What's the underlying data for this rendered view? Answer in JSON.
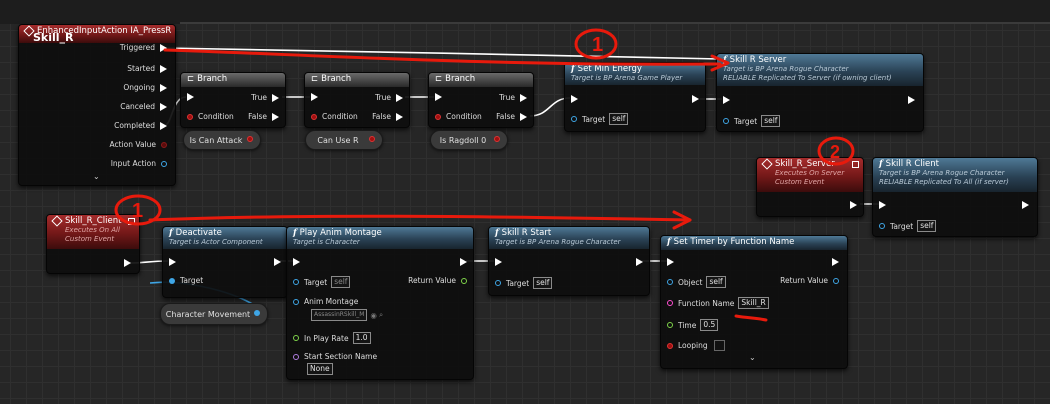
{
  "nodes": {
    "input_action": {
      "title": "EnhancedInputAction IA_PressR",
      "label": "Skill_R",
      "pins": [
        "Triggered",
        "Started",
        "Ongoing",
        "Canceled",
        "Completed",
        "Action Value",
        "Input Action"
      ]
    },
    "branch1": {
      "title": "Branch",
      "true_label": "True",
      "false_label": "False",
      "condition_label": "Condition"
    },
    "branch2": {
      "title": "Branch",
      "true_label": "True",
      "false_label": "False",
      "condition_label": "Condition"
    },
    "branch3": {
      "title": "Branch",
      "true_label": "True",
      "false_label": "False",
      "condition_label": "Condition"
    },
    "is_can_attack": {
      "label": "Is Can Attack"
    },
    "can_use_r": {
      "label": "Can Use R"
    },
    "is_ragdoll": {
      "label": "Is Ragdoll 0"
    },
    "set_min_energy": {
      "title": "Set Min Energy",
      "subtitle": "Target is BP Arena Game Player",
      "target_label": "Target",
      "target_value": "self"
    },
    "skill_r_server": {
      "title": "Skill R Server",
      "subtitle1": "Target is BP Arena Rogue Character",
      "subtitle2": "RELIABLE Replicated To Server (if owning client)",
      "target_label": "Target",
      "target_value": "self"
    },
    "skill_r_server_event": {
      "title": "Skill_R_Server",
      "subtitle1": "Executes On Server",
      "subtitle2": "Custom Event"
    },
    "skill_r_client": {
      "title": "Skill R Client",
      "subtitle1": "Target is BP Arena Rogue Character",
      "subtitle2": "RELIABLE Replicated To All (if server)",
      "target_label": "Target",
      "target_value": "self"
    },
    "skill_r_client_event": {
      "title": "Skill_R_Client",
      "subtitle1": "Executes On All",
      "subtitle2": "Custom Event"
    },
    "deactivate": {
      "title": "Deactivate",
      "subtitle": "Target is Actor Component",
      "target_label": "Target"
    },
    "character_movement": {
      "label": "Character Movement"
    },
    "play_anim_montage": {
      "title": "Play Anim Montage",
      "subtitle": "Target is Character",
      "target_label": "Target",
      "target_value": "self",
      "return_label": "Return Value",
      "anim_label": "Anim Montage",
      "anim_value": "AssassinRSkill_M",
      "rate_label": "In Play Rate",
      "rate_value": "1.0",
      "section_label": "Start Section Name",
      "section_value": "None"
    },
    "skill_r_start": {
      "title": "Skill R Start",
      "subtitle": "Target is BP Arena Rogue Character",
      "target_label": "Target",
      "target_value": "self"
    },
    "set_timer": {
      "title": "Set Timer by Function Name",
      "object_label": "Object",
      "object_value": "self",
      "return_label": "Return Value",
      "fn_label": "Function Name",
      "fn_value": "Skill_R",
      "time_label": "Time",
      "time_value": "0.5",
      "looping_label": "Looping"
    }
  },
  "annotations": {
    "num1": "1",
    "num2": "2",
    "num3": "1",
    "annotation_color": "#e81a0c"
  },
  "colors": {
    "exec": "#ffffff",
    "object_pin": "#3fa6e6",
    "bool_pin": "#a01010",
    "float_pin": "#7fd44a",
    "name_pin": "#b07ce0",
    "string_pin": "#ff4fd0",
    "func_header": "#2a4255",
    "event_header": "#721818"
  }
}
